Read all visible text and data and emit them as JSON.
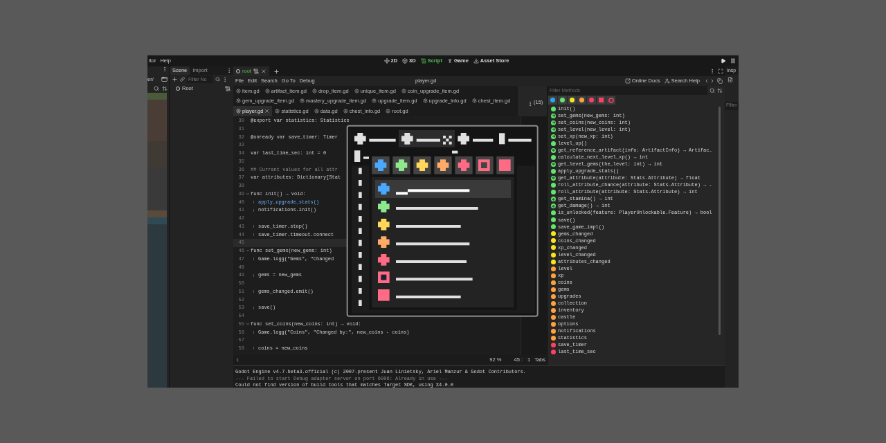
{
  "menu": [
    "itor",
    "Help"
  ],
  "workspaces": [
    {
      "label": "2D",
      "kind": "plane",
      "selected": false
    },
    {
      "label": "3D",
      "kind": "cube",
      "selected": false
    },
    {
      "label": "Script",
      "kind": "script",
      "selected": true
    },
    {
      "label": "Game",
      "kind": "game",
      "selected": false
    },
    {
      "label": "Asset Store",
      "kind": "store",
      "selected": false
    }
  ],
  "left_dock": {
    "path": "er/"
  },
  "scene_dock": {
    "tabs": [
      {
        "label": "Scene",
        "selected": true
      },
      {
        "label": "Import",
        "selected": false
      }
    ],
    "filter_placeholder": "Filter No",
    "root": "Root"
  },
  "script_tab": {
    "label": "root"
  },
  "script_menu": [
    "File",
    "Edit",
    "Search",
    "Go To",
    "Debug"
  ],
  "current_file": "player.gd",
  "help_buttons": [
    {
      "label": "Online Docs",
      "kind": "docs"
    },
    {
      "label": "Search Help",
      "kind": "help"
    }
  ],
  "file_tabs": [
    [
      {
        "label": "item.gd",
        "selected": false
      },
      {
        "label": "artifact_item.gd",
        "selected": false
      },
      {
        "label": "drop_item.gd",
        "selected": false
      },
      {
        "label": "unique_item.gd",
        "selected": false
      },
      {
        "label": "coin_upgrade_item.gd",
        "selected": false
      }
    ],
    [
      {
        "label": "gem_upgrade_item.gd",
        "selected": false
      },
      {
        "label": "mastery_upgrade_item.gd",
        "selected": false
      },
      {
        "label": "upgrade_item.gd",
        "selected": false
      },
      {
        "label": "upgrade_info.gd",
        "selected": false
      },
      {
        "label": "chest_item.gd",
        "selected": false
      }
    ],
    [
      {
        "label": "player.gd",
        "selected": true
      },
      {
        "label": "statistics.gd",
        "selected": false
      },
      {
        "label": "data.gd",
        "selected": false
      },
      {
        "label": "chest_info.gd",
        "selected": false
      },
      {
        "label": "root.gd",
        "selected": false
      }
    ]
  ],
  "overflow_count": "(15)",
  "code": [
    {
      "n": "30",
      "text": "@export var statistics: Statistics",
      "indent": false,
      "kind": "code",
      "selected": false
    },
    {
      "n": "31",
      "selected": false
    },
    {
      "n": "32",
      "text": "@onready var save_timer: Timer",
      "indent": false,
      "kind": "code",
      "selected": false
    },
    {
      "n": "33",
      "selected": false
    },
    {
      "n": "34",
      "text": "var last_time_sec: int = 0",
      "indent": false,
      "kind": "code",
      "selected": false
    },
    {
      "n": "35",
      "selected": false
    },
    {
      "n": "36",
      "text": "## Current values for all attr",
      "indent": false,
      "kind": "comment",
      "selected": false
    },
    {
      "n": "37",
      "text": "var attributes: Dictionary[Stat",
      "indent": false,
      "kind": "code",
      "selected": false
    },
    {
      "n": "38",
      "selected": false
    },
    {
      "n": "39",
      "text": "func init() → void:",
      "indent": false,
      "kind": "func",
      "selected": false
    },
    {
      "n": "40",
      "text": "apply_upgrade_stats()",
      "indent": true,
      "kind": "call",
      "selected": false
    },
    {
      "n": "41",
      "text": "notifications.init()",
      "indent": true,
      "kind": "code",
      "selected": false
    },
    {
      "n": "42",
      "selected": false
    },
    {
      "n": "43",
      "text": "save_timer.stop()",
      "indent": true,
      "kind": "code",
      "selected": false
    },
    {
      "n": "44",
      "text": "save_timer.timeout.connect",
      "indent": true,
      "kind": "code",
      "selected": false
    },
    {
      "n": "45",
      "selected": true
    },
    {
      "n": "46",
      "text": "func set_gems(new_gems: int)",
      "indent": false,
      "kind": "func",
      "selected": false
    },
    {
      "n": "47",
      "text": "Game.logg(\"Gems\", \"Changed",
      "indent": true,
      "kind": "code",
      "selected": false
    },
    {
      "n": "48",
      "selected": false
    },
    {
      "n": "49",
      "text": "gems = new_gems",
      "indent": true,
      "kind": "code",
      "selected": false
    },
    {
      "n": "50",
      "selected": false
    },
    {
      "n": "51",
      "text": "gems_changed.emit()",
      "indent": true,
      "kind": "code",
      "selected": false
    },
    {
      "n": "52",
      "selected": false
    },
    {
      "n": "53",
      "text": "save()",
      "indent": true,
      "kind": "code",
      "selected": false
    },
    {
      "n": "54",
      "selected": false
    },
    {
      "n": "55",
      "text": "func set_coins(new_coins: int) → void:",
      "indent": false,
      "kind": "func",
      "selected": false
    },
    {
      "n": "56",
      "text": "Game.logg(\"Coins\", \"Changed by:\", new_coins - coins)",
      "indent": true,
      "kind": "code",
      "selected": false
    },
    {
      "n": "57",
      "selected": false
    },
    {
      "n": "58",
      "text": "coins = new_coins",
      "indent": true,
      "kind": "code",
      "selected": false
    }
  ],
  "status": {
    "zoom": "92 %",
    "line": "45 :",
    "column": "1",
    "indent": "Tabs"
  },
  "methods": {
    "placeholder": "Filter Methods",
    "filters": [
      {
        "kind": "dot",
        "color": "#26a9f4"
      },
      {
        "kind": "dot",
        "color": "#62e46d"
      },
      {
        "kind": "dot",
        "color": "#f7e51d"
      },
      {
        "kind": "dot",
        "color": "#ffa13d"
      },
      {
        "kind": "dot",
        "color": "#ff3f63"
      },
      {
        "kind": "square",
        "color": "#ff3f63"
      },
      {
        "kind": "ring",
        "color": "#ff3f63"
      }
    ],
    "items": [
      {
        "label": "init()",
        "kind": "dot",
        "color": "#62e46d"
      },
      {
        "label": "set_gems(new_gems: int)",
        "kind": "in",
        "color": "#62e46d"
      },
      {
        "label": "set_coins(new_coins: int)",
        "kind": "in",
        "color": "#62e46d"
      },
      {
        "label": "set_level(new_level: int)",
        "kind": "in",
        "color": "#62e46d"
      },
      {
        "label": "set_xp(new_xp: int)",
        "kind": "in",
        "color": "#62e46d"
      },
      {
        "label": "level_up()",
        "kind": "dot",
        "color": "#62e46d"
      },
      {
        "label": "get_reference_artifact(info: ArtifactInfo) → Artifac…",
        "kind": "out",
        "color": "#62e46d"
      },
      {
        "label": "calculate_next_level_xp() → int",
        "kind": "dot",
        "color": "#62e46d"
      },
      {
        "label": "get_level_gems(the_level: int) → int",
        "kind": "out",
        "color": "#62e46d"
      },
      {
        "label": "apply_upgrade_stats()",
        "kind": "dot",
        "color": "#62e46d"
      },
      {
        "label": "get_attribute(attribute: Stats.Attribute) → float",
        "kind": "out",
        "color": "#62e46d"
      },
      {
        "label": "roll_attribute_chance(attribute: Stats.Attribute) → …",
        "kind": "dot",
        "color": "#62e46d"
      },
      {
        "label": "roll_attribute(attribute: Stats.Attribute) → int",
        "kind": "dot",
        "color": "#62e46d"
      },
      {
        "label": "get_stamina() → int",
        "kind": "out",
        "color": "#62e46d"
      },
      {
        "label": "get_damage() → int",
        "kind": "out",
        "color": "#62e46d"
      },
      {
        "label": "is_unlocked(feature: PlayerUnlockable.Feature) → bool",
        "kind": "dot",
        "color": "#62e46d"
      },
      {
        "label": "save()",
        "kind": "dot",
        "color": "#62e46d"
      },
      {
        "label": "save_game_impl()",
        "kind": "dot",
        "color": "#62e46d"
      },
      {
        "label": "gems_changed",
        "kind": "dot",
        "color": "#f7e51d"
      },
      {
        "label": "coins_changed",
        "kind": "dot",
        "color": "#f7e51d"
      },
      {
        "label": "xp_changed",
        "kind": "dot",
        "color": "#f7e51d"
      },
      {
        "label": "level_changed",
        "kind": "dot",
        "color": "#f7e51d"
      },
      {
        "label": "attributes_changed",
        "kind": "dot",
        "color": "#f7e51d"
      },
      {
        "label": "level",
        "kind": "dot",
        "color": "#ffa13d"
      },
      {
        "label": "xp",
        "kind": "dot",
        "color": "#ffa13d"
      },
      {
        "label": "coins",
        "kind": "dot",
        "color": "#ffa13d"
      },
      {
        "label": "gems",
        "kind": "dot",
        "color": "#ffa13d"
      },
      {
        "label": "upgrades",
        "kind": "dot",
        "color": "#ffa13d"
      },
      {
        "label": "collection",
        "kind": "dot",
        "color": "#ffa13d"
      },
      {
        "label": "inventory",
        "kind": "dot",
        "color": "#ffa13d"
      },
      {
        "label": "castle",
        "kind": "dot",
        "color": "#ffa13d"
      },
      {
        "label": "options",
        "kind": "dot",
        "color": "#ffa13d"
      },
      {
        "label": "notifications",
        "kind": "dot",
        "color": "#ffa13d"
      },
      {
        "label": "statistics",
        "kind": "dot",
        "color": "#ffa13d"
      },
      {
        "label": "save_timer",
        "kind": "dot",
        "color": "#ff3f63"
      },
      {
        "label": "last_time_sec",
        "kind": "dot",
        "color": "#ff3f63"
      }
    ]
  },
  "console": [
    {
      "text": "Godot Engine v4.7.beta3.official (c) 2007-present Juan Linietsky, Ariel Manzur & Godot Contributors.",
      "kind": "plain"
    },
    {
      "text": "--- Failed to start Debug adapter server on port 6006: Already in use ---",
      "kind": "dim"
    },
    {
      "text": "Could not find version of build tools that matches Target SDK, using 34.0.0",
      "kind": "plain"
    }
  ],
  "inspector": {
    "tab": "Insp",
    "filter_placeholder": "Filter"
  }
}
